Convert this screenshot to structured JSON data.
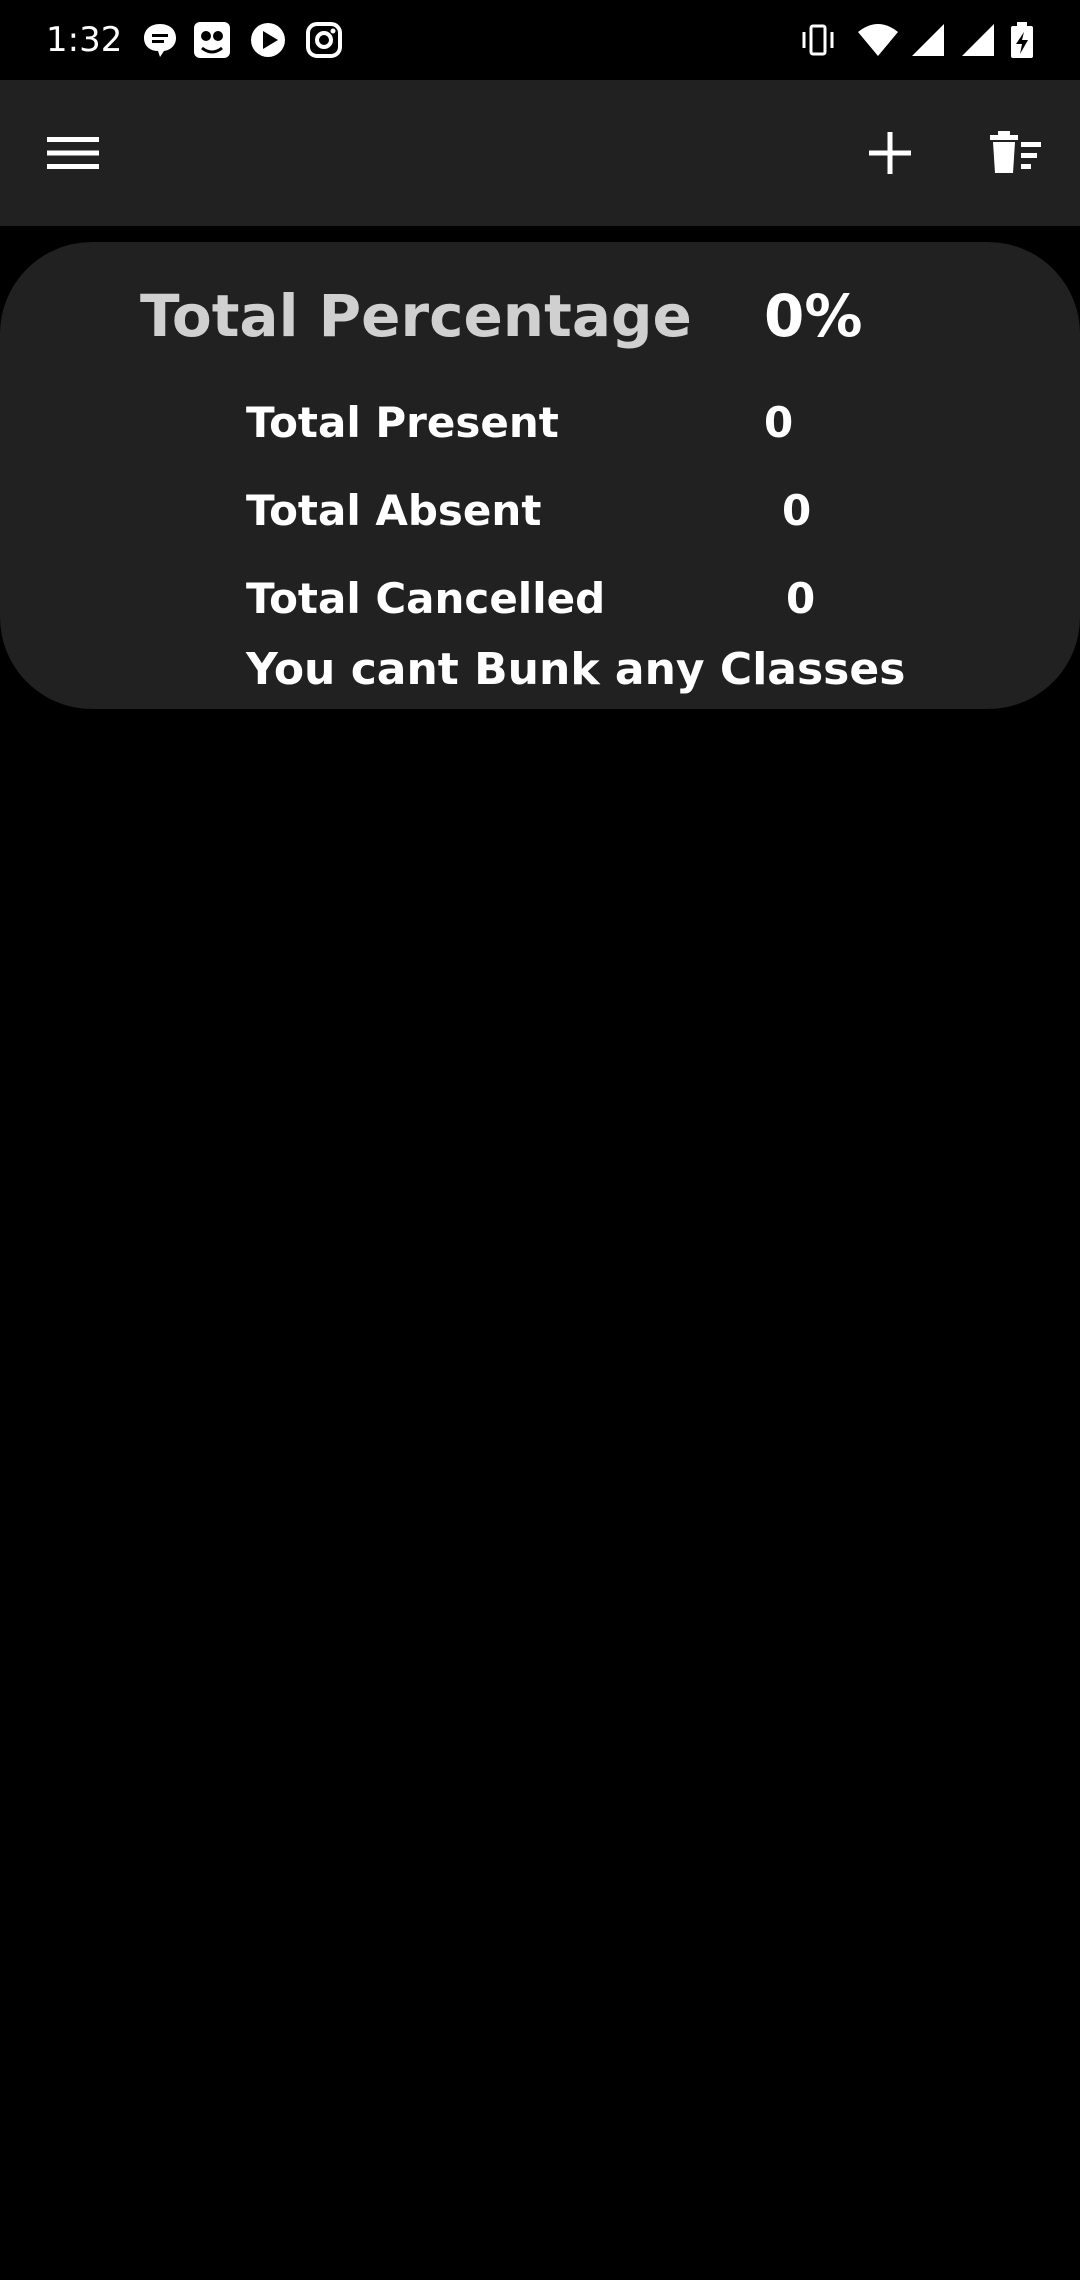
{
  "status_bar": {
    "time": "1:32",
    "left_icons": [
      "chat-bubble-icon",
      "vk-style-app-icon",
      "youtube-play-icon",
      "instagram-icon"
    ],
    "right_icons": [
      "vibrate-icon",
      "wifi-icon",
      "signal-icon",
      "signal-icon-2",
      "battery-charging-icon"
    ]
  },
  "toolbar": {
    "menu_icon": "hamburger-menu-icon",
    "add_icon": "plus-icon",
    "clear_icon": "delete-sweep-icon"
  },
  "summary": {
    "total_percentage_label": "Total Percentage",
    "total_percentage_value": "0%",
    "total_present_label": "Total Present",
    "total_present_value": "0",
    "total_absent_label": "Total Absent",
    "total_absent_value": "0",
    "total_cancelled_label": "Total Cancelled",
    "total_cancelled_value": "0",
    "bunk_message": "You cant Bunk any Classes"
  },
  "colors": {
    "background": "#000000",
    "surface": "#212121",
    "text_primary": "#ffffff",
    "text_secondary": "#d0d0d0"
  }
}
